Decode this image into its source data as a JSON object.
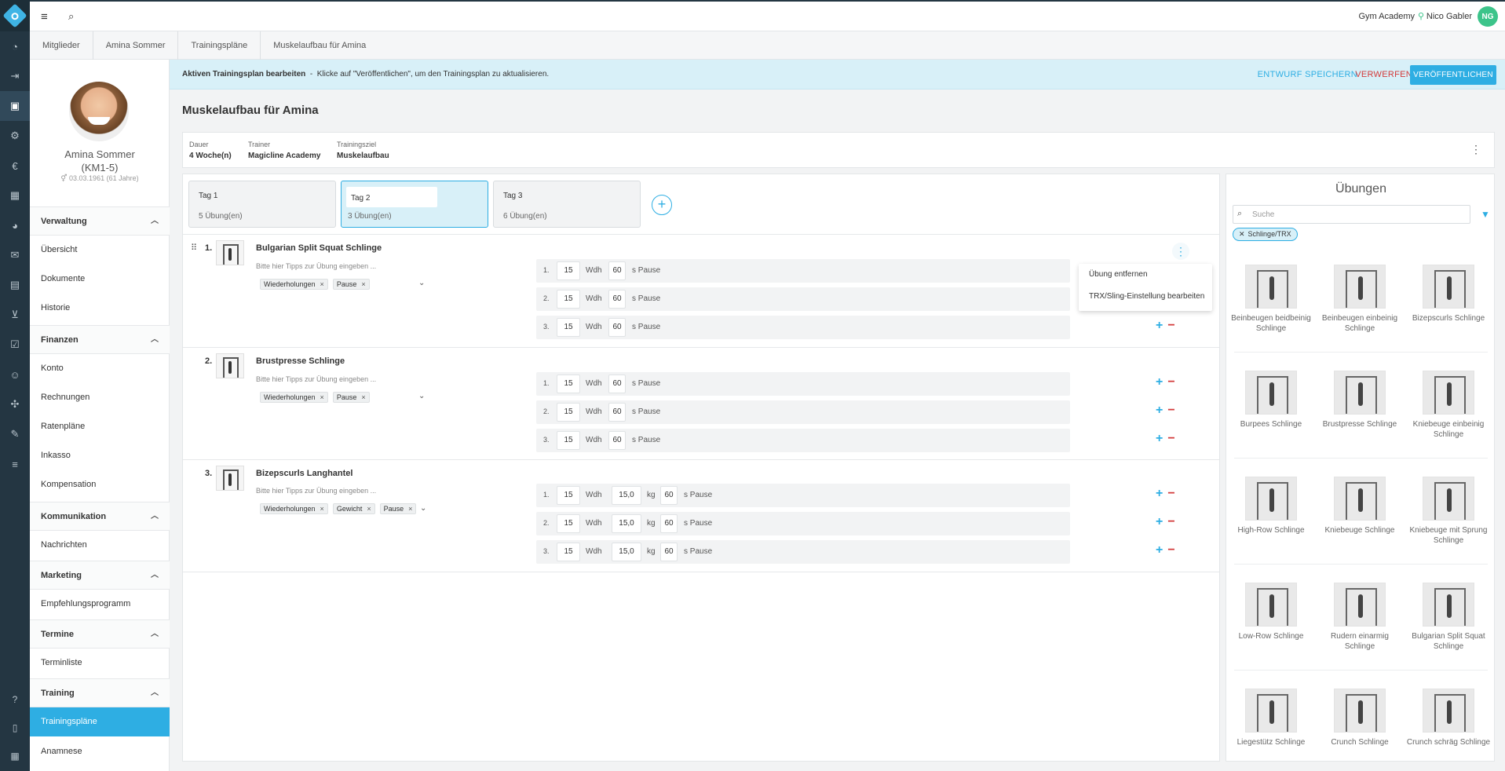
{
  "topbar": {
    "studio": "Gym Academy",
    "user": "Nico Gabler",
    "initials": "NG"
  },
  "breadcrumb": [
    "Mitglieder",
    "Amina Sommer",
    "Trainingspläne",
    "Muskelaufbau für Amina"
  ],
  "member": {
    "name": "Amina Sommer",
    "id": "(KM1-5)",
    "dob": "03.03.1961 (61 Jahre)"
  },
  "nav": {
    "sections": [
      {
        "title": "Verwaltung",
        "items": [
          "Übersicht",
          "Dokumente",
          "Historie"
        ]
      },
      {
        "title": "Finanzen",
        "items": [
          "Konto",
          "Rechnungen",
          "Ratenpläne",
          "Inkasso",
          "Kompensation"
        ]
      },
      {
        "title": "Kommunikation",
        "items": [
          "Nachrichten"
        ]
      },
      {
        "title": "Marketing",
        "items": [
          "Empfehlungsprogramm"
        ]
      },
      {
        "title": "Termine",
        "items": [
          "Terminliste"
        ]
      },
      {
        "title": "Training",
        "items": [
          "Trainingspläne",
          "Anamnese"
        ]
      }
    ]
  },
  "banner": {
    "title": "Aktiven Trainingsplan bearbeiten",
    "sep": "-",
    "text": "Klicke auf \"Veröffentlichen\", um den Trainingsplan zu aktualisieren.",
    "save_draft": "ENTWURF SPEICHERN",
    "discard": "VERWERFEN",
    "publish": "VERÖFFENTLICHEN"
  },
  "plan": {
    "title": "Muskelaufbau für Amina",
    "info": [
      {
        "label": "Dauer",
        "value": "4 Woche(n)"
      },
      {
        "label": "Trainer",
        "value": "Magicline Academy"
      },
      {
        "label": "Trainingsziel",
        "value": "Muskelaufbau"
      }
    ]
  },
  "tabs": [
    {
      "label": "Tag 1",
      "count": "5 Übung(en)"
    },
    {
      "label": "Tag 2",
      "count": "3 Übung(en)"
    },
    {
      "label": "Tag 3",
      "count": "6 Übung(en)"
    }
  ],
  "exercises": [
    {
      "num": "1.",
      "name": "Bulgarian Split Squat Schlinge",
      "tips": "Bitte hier Tipps zur Übung eingeben ...",
      "chips": [
        "Wiederholungen",
        "Pause"
      ],
      "sets": [
        {
          "n": "1.",
          "reps": "15",
          "pause": "60"
        },
        {
          "n": "2.",
          "reps": "15",
          "pause": "60"
        },
        {
          "n": "3.",
          "reps": "15",
          "pause": "60"
        }
      ]
    },
    {
      "num": "2.",
      "name": "Brustpresse Schlinge",
      "tips": "Bitte hier Tipps zur Übung eingeben ...",
      "chips": [
        "Wiederholungen",
        "Pause"
      ],
      "sets": [
        {
          "n": "1.",
          "reps": "15",
          "pause": "60"
        },
        {
          "n": "2.",
          "reps": "15",
          "pause": "60"
        },
        {
          "n": "3.",
          "reps": "15",
          "pause": "60"
        }
      ]
    },
    {
      "num": "3.",
      "name": "Bizepscurls Langhantel",
      "tips": "Bitte hier Tipps zur Übung eingeben ...",
      "chips": [
        "Wiederholungen",
        "Gewicht",
        "Pause"
      ],
      "sets": [
        {
          "n": "1.",
          "reps": "15",
          "weight": "15,0",
          "pause": "60"
        },
        {
          "n": "2.",
          "reps": "15",
          "weight": "15,0",
          "pause": "60"
        },
        {
          "n": "3.",
          "reps": "15",
          "weight": "15,0",
          "pause": "60"
        }
      ]
    }
  ],
  "units": {
    "reps": "Wdh",
    "weight": "kg",
    "pause": "s Pause"
  },
  "context_menu": [
    "Übung entfernen",
    "TRX/Sling-Einstellung bearbeiten"
  ],
  "library": {
    "title": "Übungen",
    "search_placeholder": "Suche",
    "filter_chip": "Schlinge/TRX",
    "items": [
      "Beinbeugen beidbeinig Schlinge",
      "Beinbeugen einbeinig Schlinge",
      "Bizepscurls Schlinge",
      "Burpees Schlinge",
      "Brustpresse Schlinge",
      "Kniebeuge einbeinig Schlinge",
      "High-Row Schlinge",
      "Kniebeuge Schlinge",
      "Kniebeuge mit Sprung Schlinge",
      "Low-Row Schlinge",
      "Rudern einarmig Schlinge",
      "Bulgarian Split Squat Schlinge",
      "Liegestütz Schlinge",
      "Crunch Schlinge",
      "Crunch schräg Schlinge"
    ]
  },
  "colors": {
    "accent": "#2eaee3",
    "danger": "#d33a3a",
    "rail": "#243642",
    "success": "#3cc48a"
  }
}
